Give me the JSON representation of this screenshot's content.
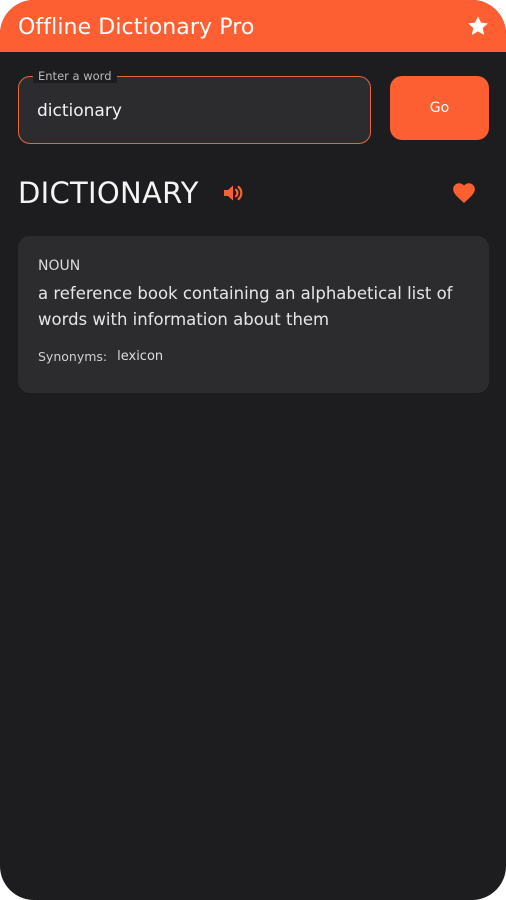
{
  "app": {
    "title": "Offline Dictionary Pro",
    "star_icon": "star-icon"
  },
  "search": {
    "label": "Enter a word",
    "value": "dictionary",
    "go_label": "Go"
  },
  "entry": {
    "word": "DICTIONARY",
    "speaker_icon": "speaker-icon",
    "favorite_icon": "heart-icon",
    "meanings": [
      {
        "part_of_speech": "NOUN",
        "definition": "a reference book containing an alphabetical list of words with information about them",
        "synonyms_label": "Synonyms:",
        "synonyms": "lexicon"
      }
    ]
  },
  "colors": {
    "accent": "#fd5f33",
    "background": "#1d1d1f",
    "surface": "#2c2c2f",
    "text": "#f4f4f4"
  }
}
